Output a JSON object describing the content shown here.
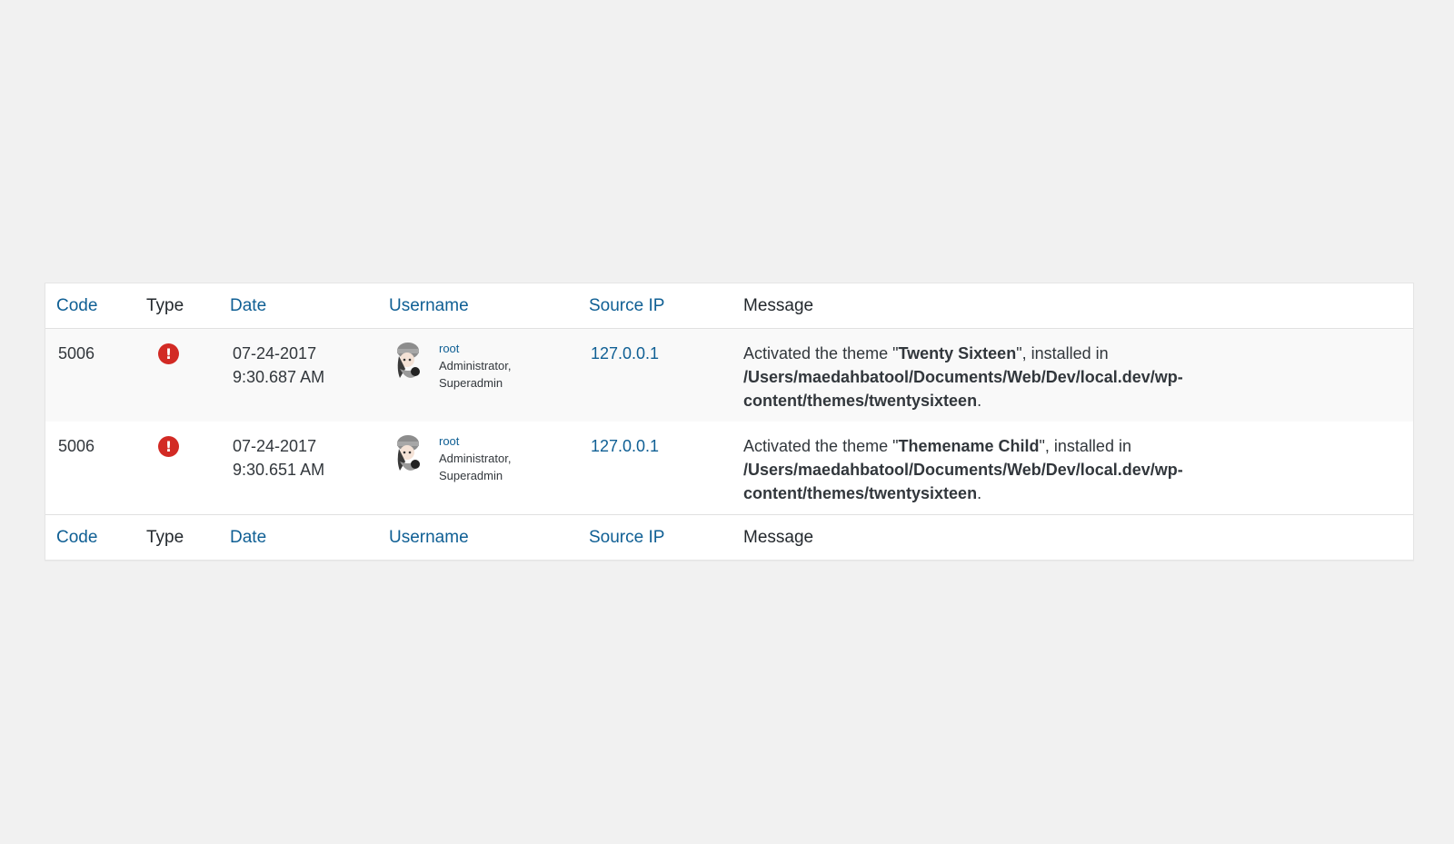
{
  "columns": {
    "code": "Code",
    "type": "Type",
    "date": "Date",
    "username": "Username",
    "source_ip": "Source IP",
    "message": "Message"
  },
  "rows": [
    {
      "code": "5006",
      "type_icon": "error-icon",
      "type_glyph": "!",
      "date": "07-24-2017",
      "time": "9:30.687 AM",
      "username": "root",
      "roles_line1": "Administrator,",
      "roles_line2": "Superadmin",
      "source_ip": "127.0.0.1",
      "message_prefix": "Activated the theme \"",
      "theme_name": "Twenty Sixteen",
      "message_mid": "\", installed in",
      "path": "/Users/maedahbatool/Documents/Web/Dev/local.dev/wp-content/themes/twentysixteen",
      "message_suffix": "."
    },
    {
      "code": "5006",
      "type_icon": "error-icon",
      "type_glyph": "!",
      "date": "07-24-2017",
      "time": "9:30.651 AM",
      "username": "root",
      "roles_line1": "Administrator,",
      "roles_line2": "Superadmin",
      "source_ip": "127.0.0.1",
      "message_prefix": "Activated the theme \"",
      "theme_name": "Themename Child",
      "message_mid": "\", installed in",
      "path": "/Users/maedahbatool/Documents/Web/Dev/local.dev/wp-content/themes/twentysixteen",
      "message_suffix": "."
    }
  ],
  "colors": {
    "link": "#0f5f94",
    "error": "#d22a24",
    "text": "#32373c",
    "page_bg": "#f1f1f1"
  }
}
